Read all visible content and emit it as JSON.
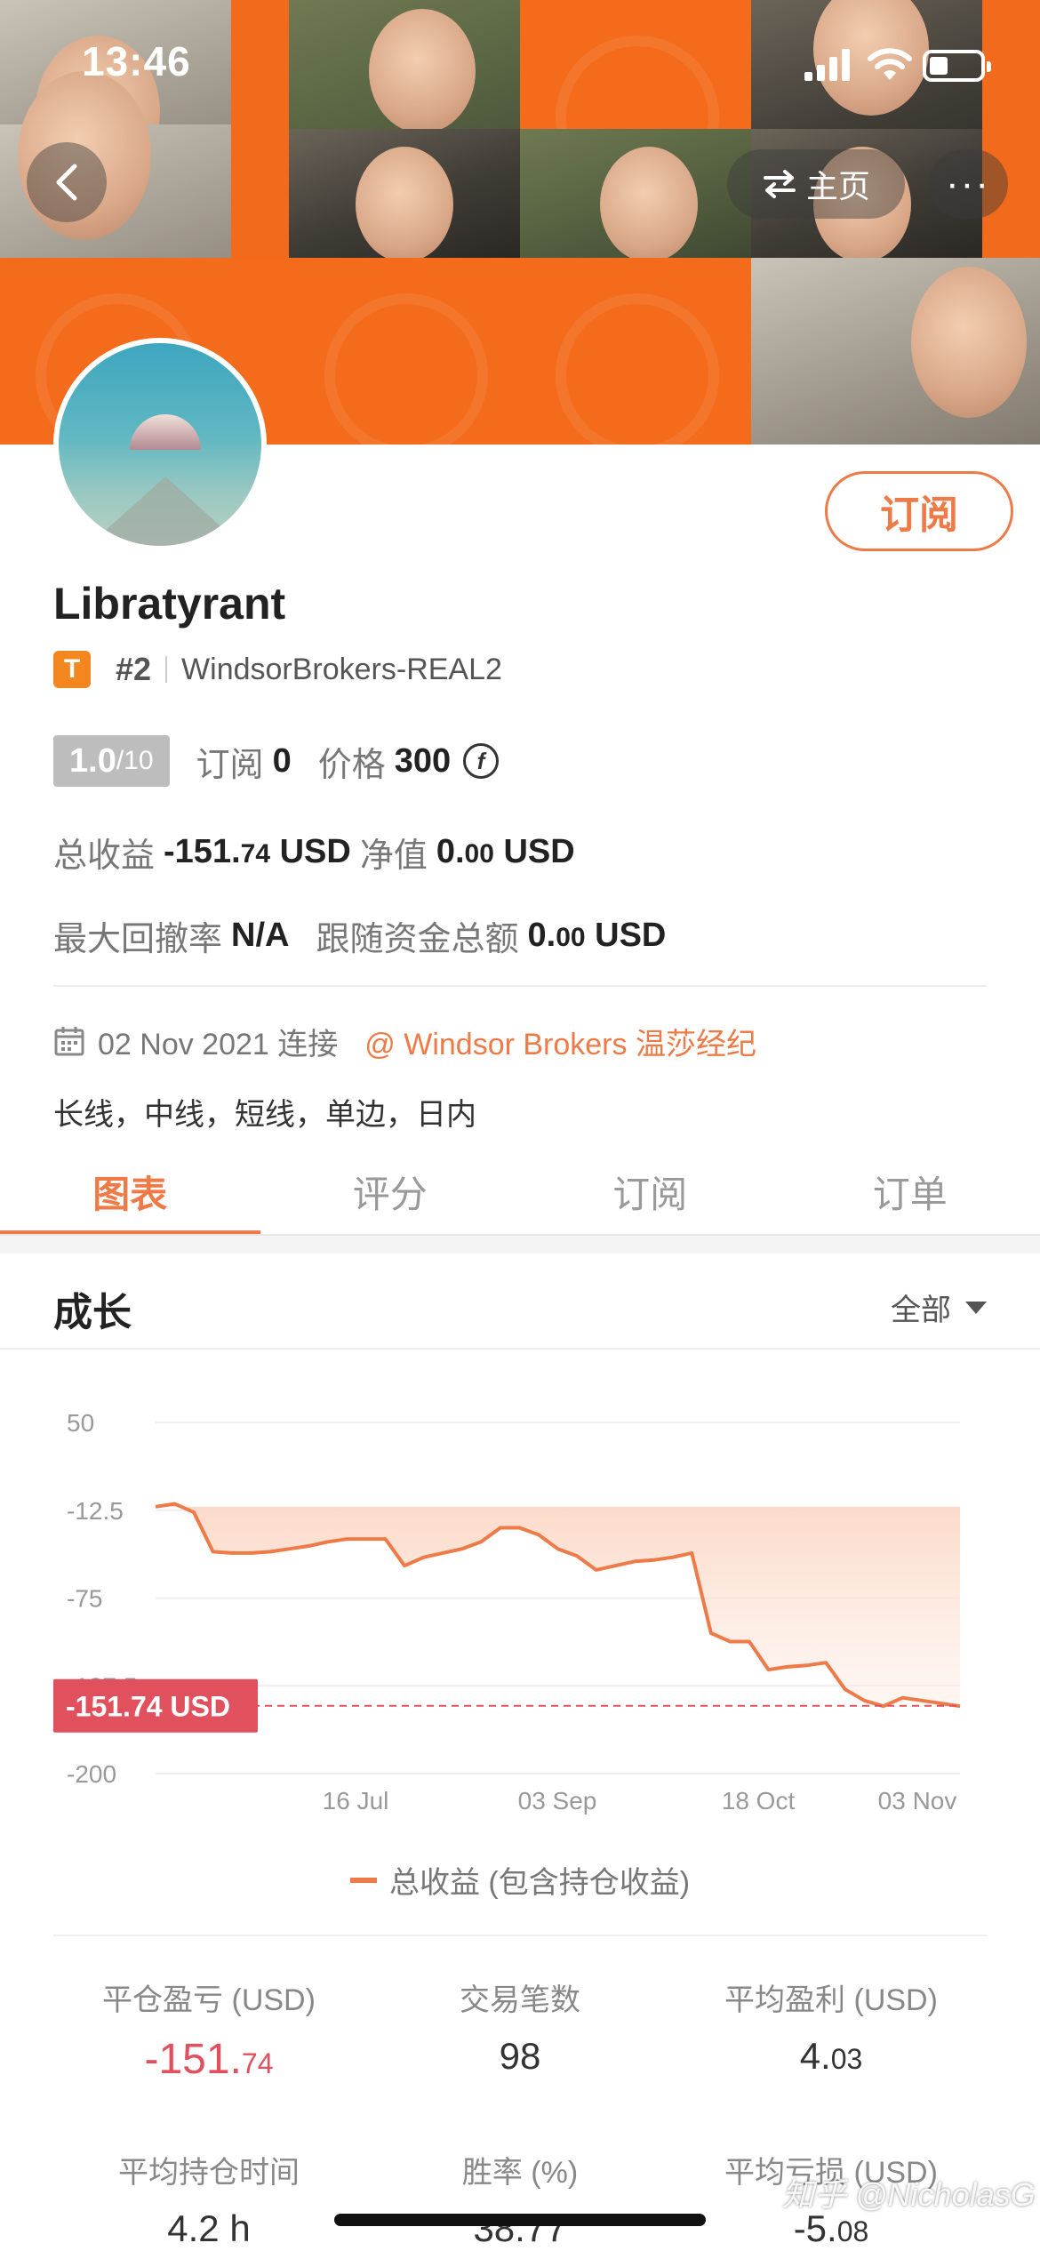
{
  "status_bar": {
    "time": "13:46"
  },
  "nav": {
    "home_label": "主页",
    "more_label": "···"
  },
  "profile": {
    "name": "Libratyrant",
    "badge_letter": "T",
    "rank": "#2",
    "broker_account": "WindsorBrokers-REAL2",
    "subscribe_label": "订阅",
    "score": "1.0",
    "score_max": "/10",
    "subscriptions_label": "订阅",
    "subscriptions_value": "0",
    "price_label": "价格",
    "price_value": "300",
    "total_profit_label": "总收益",
    "total_profit_int": "-151.",
    "total_profit_dec": "74",
    "total_profit_unit": "USD",
    "net_value_label": "净值",
    "net_value_int": "0.",
    "net_value_dec": "00",
    "net_value_unit": "USD",
    "max_drawdown_label": "最大回撤率",
    "max_drawdown_value": "N/A",
    "follow_funds_label": "跟随资金总额",
    "follow_funds_int": "0.",
    "follow_funds_dec": "00",
    "follow_funds_unit": "USD",
    "join_date": "02 Nov 2021 连接",
    "broker_link": "@ Windsor Brokers 温莎经纪",
    "tags": "长线，中线，短线，单边，日内"
  },
  "tabs": [
    {
      "label": "图表",
      "active": true
    },
    {
      "label": "评分",
      "active": false
    },
    {
      "label": "订阅",
      "active": false
    },
    {
      "label": "订单",
      "active": false
    }
  ],
  "growth": {
    "title": "成长",
    "range_label": "全部"
  },
  "chart_data": {
    "type": "line",
    "yticks": [
      "50",
      "-12.5",
      "-75",
      "-137.5",
      "-200"
    ],
    "ylim": [
      -200,
      50
    ],
    "xticks": [
      "16 Jul",
      "03 Sep",
      "18 Oct",
      "03 Nov"
    ],
    "current_value_label": "-151.74 USD",
    "current_value": -151.74,
    "legend": "总收益 (包含持仓收益)",
    "series": [
      {
        "name": "总收益 (包含持仓收益)",
        "values": [
          -10,
          -8,
          -14,
          -42,
          -43,
          -43,
          -42,
          -40,
          -38,
          -35,
          -33,
          -33,
          -33,
          -52,
          -46,
          -43,
          -40,
          -35,
          -25,
          -25,
          -30,
          -40,
          -45,
          -55,
          -52,
          -49,
          -48,
          -46,
          -43,
          -100,
          -106,
          -106,
          -126,
          -124,
          -123,
          -121,
          -140,
          -148,
          -152,
          -146,
          -148,
          -150,
          -152
        ]
      }
    ],
    "colors": {
      "line": "#ee7b47",
      "fill": "#fbd8c6",
      "marker": "#e0505d"
    }
  },
  "summary": [
    {
      "label": "平仓盈亏 (USD)",
      "value_int": "-151.",
      "value_dec": "74",
      "negative": true
    },
    {
      "label": "交易笔数",
      "value_int": "98",
      "value_dec": "",
      "negative": false
    },
    {
      "label": "平均盈利 (USD)",
      "value_int": "4.",
      "value_dec": "03",
      "negative": false
    },
    {
      "label": "平均持仓时间",
      "value_int": "4.2 h",
      "value_dec": "",
      "negative": false
    },
    {
      "label": "胜率 (%)",
      "value_int": "38.77",
      "value_dec": "",
      "negative": false
    },
    {
      "label": "平均亏损 (USD)",
      "value_int": "-5.",
      "value_dec": "08",
      "negative": false
    }
  ],
  "watermark": "知乎 @NicholasG"
}
